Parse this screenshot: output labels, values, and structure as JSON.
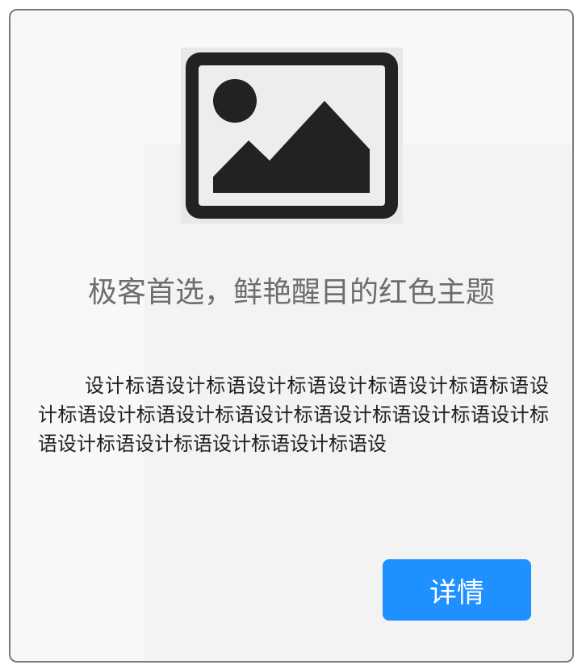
{
  "card": {
    "image_icon": "image-placeholder-icon",
    "title": "极客首选，鲜艳醒目的红色主题",
    "description": "设计标语设计标语设计标语设计标语设计标语标语设计标语设计标语设计标语设计标语设计标语设计标语设计标语设计标语设计标语设计标语设计标语设",
    "button_label": "详情"
  },
  "colors": {
    "button": "#1e90ff",
    "border": "#7a7a7a",
    "title": "#6d6d6d"
  }
}
